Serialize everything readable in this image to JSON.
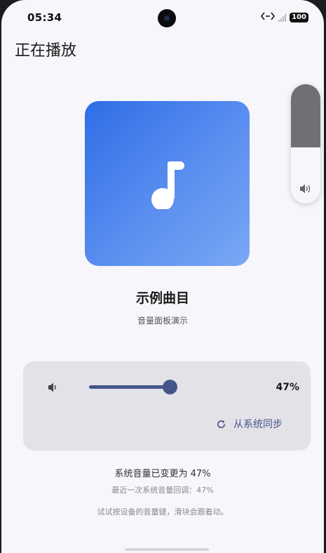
{
  "status_bar": {
    "time": "05:34",
    "battery": "100",
    "icons": [
      "data-transfer-icon",
      "no-signal-icon",
      "battery-icon"
    ]
  },
  "page": {
    "title": "正在播放"
  },
  "track": {
    "title": "示例曲目",
    "subtitle": "音量面板演示",
    "art_icon": "music-note-icon",
    "art_colors": [
      "#2f6ee6",
      "#7aa8f5"
    ]
  },
  "volume_panel": {
    "level": 0.47,
    "percent_label": "47%",
    "sync_label": "从系统同步",
    "sync_icon": "refresh-icon",
    "accent": "#45558a"
  },
  "system_volume_overlay": {
    "level": 0.53,
    "icon": "speaker-icon"
  },
  "messages": {
    "changed": "系统音量已变更为 47%",
    "last_adjust": "最近一次系统音量回调：47%",
    "hint": "试试按设备的音量键，滑块会跟着动。"
  }
}
